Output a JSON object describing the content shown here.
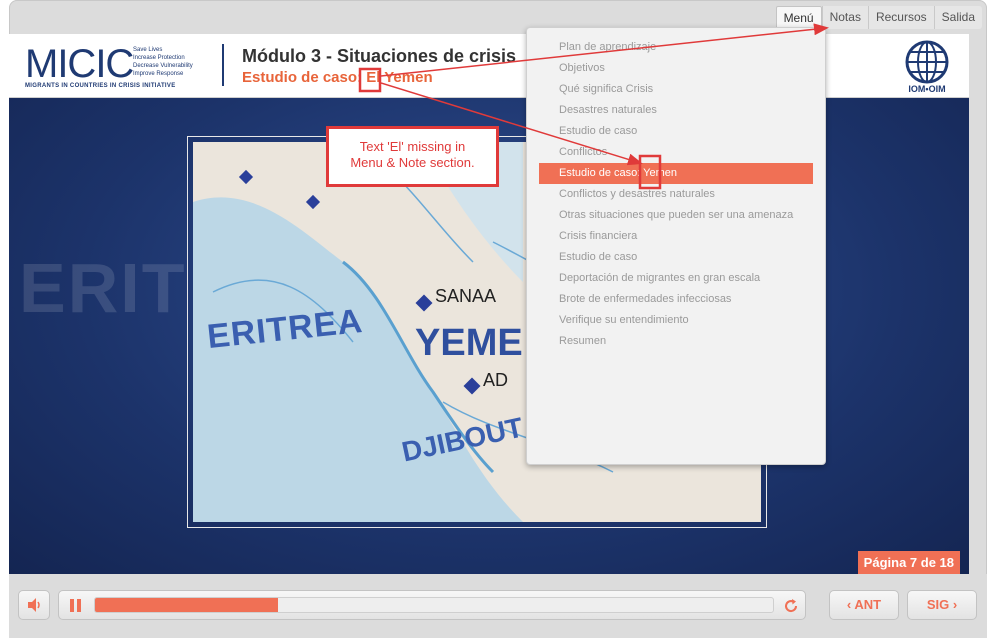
{
  "topnav": {
    "items": [
      "Menú",
      "Notas",
      "Recursos",
      "Salida"
    ],
    "active_index": 0
  },
  "header": {
    "micic_word": "MICIC",
    "micic_taglines": [
      "Save Lives",
      "Increase Protection",
      "Decrease Vulnerability",
      "Improve Response"
    ],
    "micic_sub": "MIGRANTS IN COUNTRIES IN CRISIS INITIATIVE",
    "module_title": "Módulo 3 - Situaciones de crisis",
    "case_title": "Estudio de caso: El Yemen",
    "iom_text": "IOM•OIM"
  },
  "menu": {
    "items": [
      "Plan de aprendizaje",
      "Objetivos",
      "Qué significa Crisis",
      "Desastres naturales",
      "Estudio de caso",
      "Conflictos",
      "Estudio de caso: Yemen",
      "Conflictos y desastres naturales",
      "Otras situaciones que pueden ser una amenaza",
      "Crisis financiera",
      "Estudio de caso",
      "Deportación de migrantes en gran escala",
      "Brote de enfermedades infecciosas",
      "Verifique su entendimiento",
      "Resumen"
    ],
    "selected_index": 6
  },
  "annotation": {
    "line1": "Text 'El' missing in",
    "line2": "Menu & Note section."
  },
  "map_labels": {
    "eritrea": "ERITREA",
    "yemen": "YEME",
    "sanaa": "SANAA",
    "djibouti": "DJIBOUT",
    "aden": "AD",
    "background_eritrea": "ERIT"
  },
  "page_indicator": "Página 7 de 18",
  "player": {
    "progress": 0.27,
    "prev_label": "ANT",
    "next_label": "SIG",
    "prev_glyph": "‹",
    "next_glyph": "›"
  },
  "colors": {
    "accent": "#f07055",
    "brand_blue": "#1f3a73",
    "annotation_red": "#e03a3a"
  }
}
